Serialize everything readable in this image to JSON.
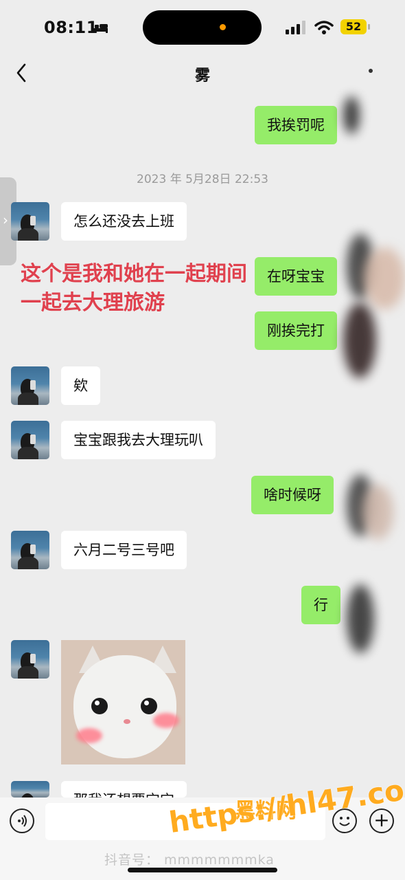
{
  "status_bar": {
    "time": "08:11",
    "battery": "52",
    "accent_dot": "#ff9a00"
  },
  "nav": {
    "title": "雾"
  },
  "chat": {
    "timestamp": "2023 年 5月28日  22:53",
    "messages": [
      {
        "side": "out",
        "text": "我挨罚呢"
      },
      {
        "side": "in",
        "text": "怎么还没去上班"
      },
      {
        "side": "out",
        "text": "在呀宝宝"
      },
      {
        "side": "out",
        "text": "刚挨完打"
      },
      {
        "side": "in",
        "text": "欸"
      },
      {
        "side": "in",
        "text": "宝宝跟我去大理玩叭"
      },
      {
        "side": "out",
        "text": "啥时候呀"
      },
      {
        "side": "in",
        "text": "六月二号三号吧"
      },
      {
        "side": "out",
        "text": "行"
      },
      {
        "side": "in",
        "type": "sticker",
        "text": ""
      },
      {
        "side": "in",
        "text": "那我还想要宝宝"
      }
    ]
  },
  "overlay": {
    "line1": "这个是我和她在一起期间",
    "line2": "一起去大理旅游",
    "color": "#e0414e"
  },
  "watermark": {
    "site_name": "黑料网",
    "url": "https://hl47.co",
    "douyin": "抖音号： mmmmmmmka",
    "color": "#ffab1f"
  },
  "colors": {
    "outgoing_bubble": "#95ec69",
    "incoming_bubble": "#ffffff",
    "background": "#ededed"
  }
}
